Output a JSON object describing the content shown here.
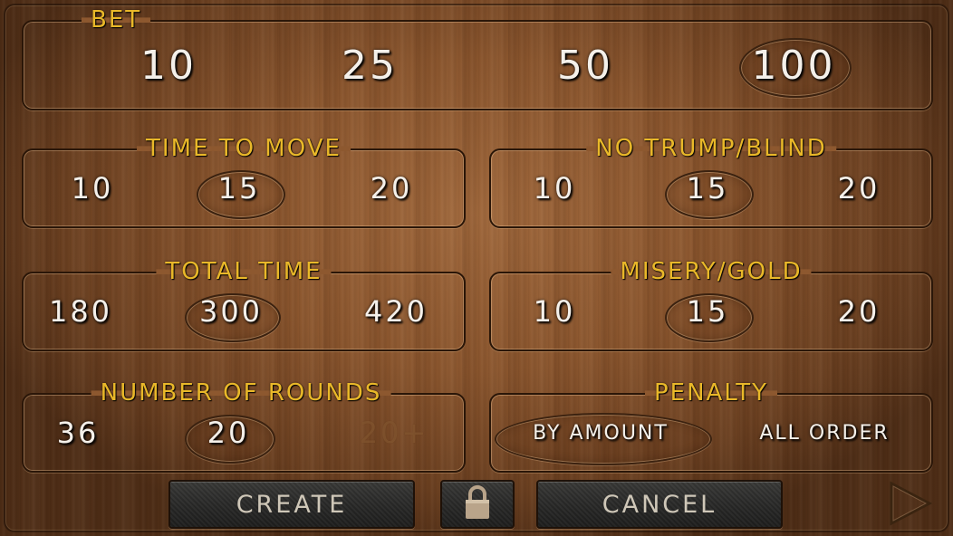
{
  "bet": {
    "title": "BET",
    "options": [
      "10",
      "25",
      "50",
      "100"
    ],
    "selected": "100"
  },
  "time_to_move": {
    "title": "TIME TO MOVE",
    "options": [
      "10",
      "15",
      "20"
    ],
    "selected": "15"
  },
  "no_trump_blind": {
    "title": "NO TRUMP/BLIND",
    "options": [
      "10",
      "15",
      "20"
    ],
    "selected": "15"
  },
  "total_time": {
    "title": "TOTAL TIME",
    "options": [
      "180",
      "300",
      "420"
    ],
    "selected": "300"
  },
  "misery_gold": {
    "title": "MISERY/GOLD",
    "options": [
      "10",
      "15",
      "20"
    ],
    "selected": "15"
  },
  "number_of_rounds": {
    "title": "NUMBER OF ROUNDS",
    "options": [
      "36",
      "20",
      "20+"
    ],
    "selected": "20",
    "disabled": "20+"
  },
  "penalty": {
    "title": "PENALTY",
    "options": [
      "BY AMOUNT",
      "ALL ORDER"
    ],
    "selected": "BY AMOUNT"
  },
  "actions": {
    "create_label": "CREATE",
    "cancel_label": "CANCEL",
    "lock_icon": "lock-icon",
    "next_icon": "play-arrow-icon"
  },
  "colors": {
    "title_gold": "#e9b829",
    "option_text": "#f4f0ea",
    "button_text": "#cfc7b8",
    "wood": "#8a552d"
  }
}
